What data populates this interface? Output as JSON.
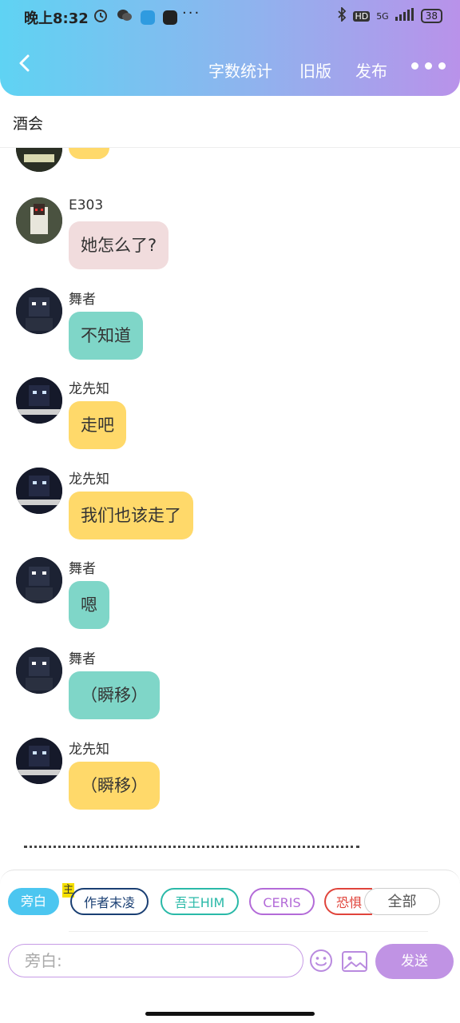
{
  "status_bar": {
    "time": "晚上8:32",
    "more": "···",
    "network": "HD",
    "signal": "5G",
    "battery": "38"
  },
  "header": {
    "back_icon": "chevron-left-icon",
    "word_count": "字数统计",
    "old_version": "旧版",
    "publish": "发布",
    "more_icon": "more-dots-icon"
  },
  "chat_title": "酒会",
  "messages": [
    {
      "name": "",
      "text": "！",
      "color": "#ffd96a"
    },
    {
      "name": "E303",
      "text": "她怎么了?",
      "color": "#f1dcdd"
    },
    {
      "name": "舞者",
      "text": "不知道",
      "color": "#7fd6c8"
    },
    {
      "name": "龙先知",
      "text": "走吧",
      "color": "#ffd96a"
    },
    {
      "name": "龙先知",
      "text": "我们也该走了",
      "color": "#ffd96a"
    },
    {
      "name": "舞者",
      "text": "嗯",
      "color": "#7fd6c8"
    },
    {
      "name": "舞者",
      "text": "（瞬移）",
      "color": "#7fd6c8"
    },
    {
      "name": "龙先知",
      "text": "（瞬移）",
      "color": "#ffd96a"
    }
  ],
  "roles": {
    "narration": "旁白",
    "host_tag": "主",
    "author": "作者末凌",
    "wuwang": "吾王HIM",
    "ceris": "CERIS",
    "fear": "恐惧",
    "all": "全部"
  },
  "composer": {
    "placeholder": "旁白:",
    "send": "发送",
    "emoji_icon": "emoji-icon",
    "image_icon": "image-icon"
  }
}
